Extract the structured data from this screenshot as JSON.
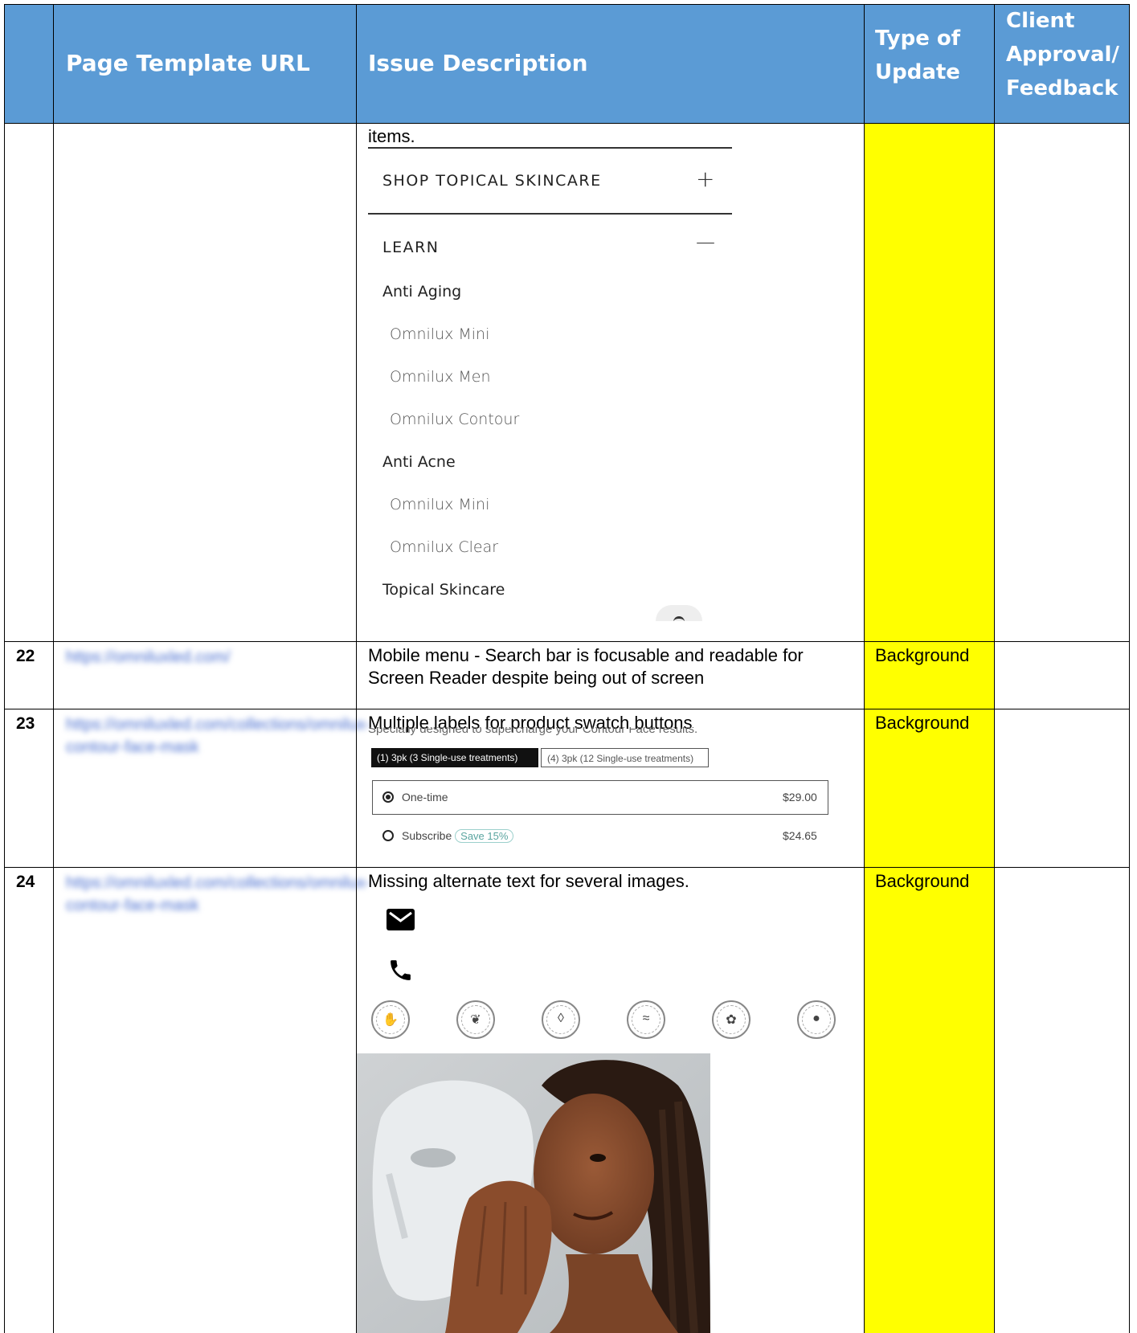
{
  "table": {
    "headers": {
      "num": "",
      "url": "Page Template URL",
      "issue": "Issue Description",
      "type_line1": "Type of",
      "type_line2": "Update",
      "client_line1": "Client",
      "client_line2": "Approval/",
      "client_line3": "Feedback"
    },
    "continued_row": {
      "issue_tail": "items.",
      "menu": {
        "shop_label": "SHOP TOPICAL SKINCARE",
        "shop_toggle": "+",
        "learn_label": "LEARN",
        "learn_toggle": "—",
        "categories": [
          {
            "name": "Anti Aging",
            "items": [
              "Omnilux Mini",
              "Omnilux Men",
              "Omnilux Contour"
            ]
          },
          {
            "name": "Anti Acne",
            "items": [
              "Omnilux Mini",
              "Omnilux Clear"
            ]
          },
          {
            "name": "Topical Skincare",
            "items": []
          }
        ]
      }
    },
    "rows": [
      {
        "number": "22",
        "url": "https://omniluxled.com/",
        "issue": "Mobile menu - Search bar is focusable and readable for Screen Reader despite being out of screen",
        "type": "Background",
        "client": ""
      },
      {
        "number": "23",
        "url": "https://omniluxled.com/collections/omnilux-contour-face-mask",
        "issue": "Multiple labels for product swatch buttons",
        "type": "Background",
        "client": "",
        "swatch": {
          "cut_text": "Specially designed to supercharge your Contour Face results.",
          "option_active": "(1) 3pk (3 Single-use treatments)",
          "option_inactive": "(4) 3pk (12 Single-use treatments)",
          "one_time_label": "One-time",
          "one_time_price": "$29.00",
          "subscribe_label": "Subscribe",
          "subscribe_badge": "Save 15%",
          "subscribe_price": "$24.65"
        }
      },
      {
        "number": "24",
        "url": "https://omniluxled.com/collections/omnilux-contour-face-mask",
        "issue": "Missing alternate text for several images.",
        "type": "Background",
        "client": ""
      }
    ]
  },
  "colors": {
    "header_bg": "#5b9bd5",
    "highlight": "#ffff00",
    "link": "#4a6fd0"
  },
  "icons": [
    "mail-icon",
    "phone-icon",
    "badge-hands-icon",
    "badge-leaf-icon",
    "badge-drop-icon",
    "badge-water-icon",
    "badge-bunny-icon",
    "badge-flame-icon"
  ]
}
